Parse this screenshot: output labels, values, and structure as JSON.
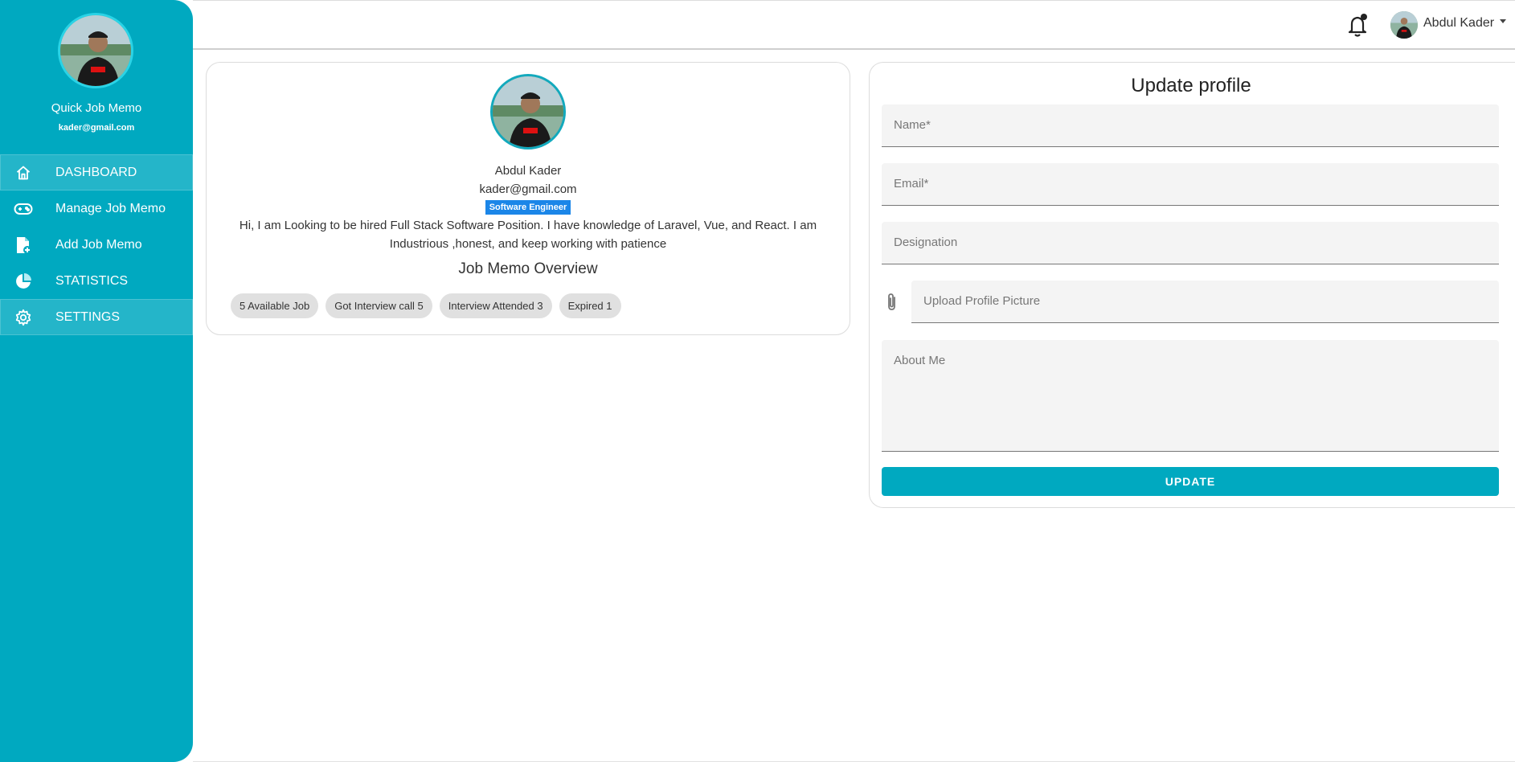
{
  "sidebar": {
    "app_name": "Quick Job Memo",
    "email": "kader@gmail.com",
    "items": [
      {
        "label": "DASHBOARD",
        "icon": "home-icon",
        "active": true
      },
      {
        "label": "Manage Job Memo",
        "icon": "gamepad-icon",
        "active": false
      },
      {
        "label": "Add Job Memo",
        "icon": "add-file-icon",
        "active": false
      },
      {
        "label": "STATISTICS",
        "icon": "pie-chart-icon",
        "active": false
      },
      {
        "label": "SETTINGS",
        "icon": "gear-icon",
        "active": true
      }
    ]
  },
  "topbar": {
    "user_name": "Abdul Kader",
    "notification_icon": "bell-icon"
  },
  "profile": {
    "name": "Abdul Kader",
    "email": "kader@gmail.com",
    "designation": "Software Engineer",
    "bio": "Hi, I am Looking to be hired Full Stack Software Position. I have knowledge of Laravel, Vue, and React. I am Industrious ,honest, and keep working with patience",
    "overview_title": "Job Memo Overview",
    "chips": [
      "5 Available Job",
      "Got Interview call 5",
      "Interview Attended 3",
      "Expired 1"
    ]
  },
  "update_form": {
    "title": "Update profile",
    "name_placeholder": "Name*",
    "email_placeholder": "Email*",
    "designation_placeholder": "Designation",
    "upload_placeholder": "Upload Profile Picture",
    "about_placeholder": "About Me",
    "submit_label": "UPDATE"
  },
  "colors": {
    "brand": "#00a9c0",
    "badge": "#1b86e8",
    "chip": "#e0e0e0"
  }
}
